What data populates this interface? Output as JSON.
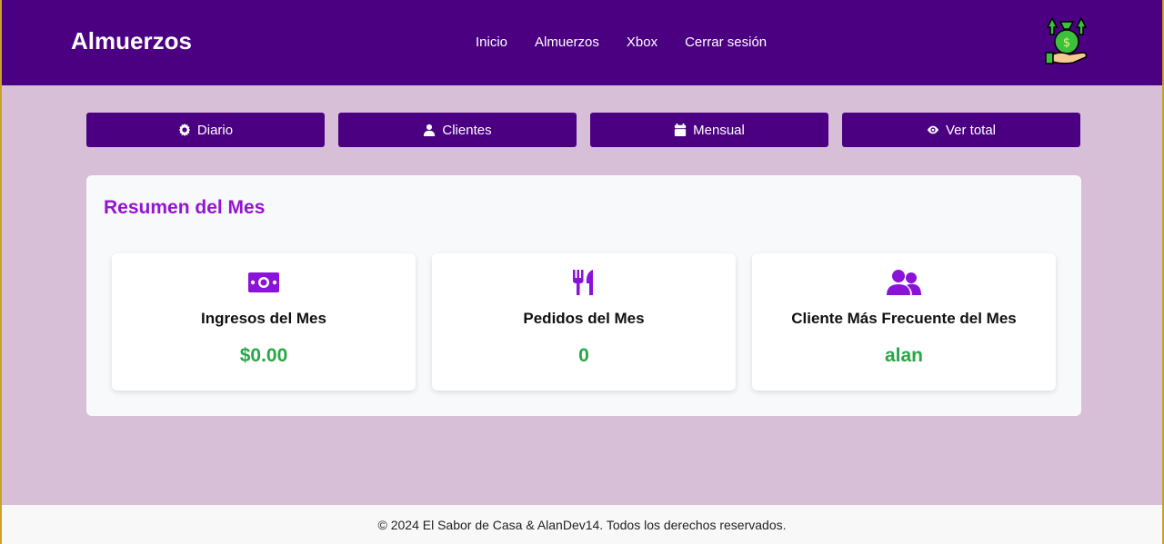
{
  "navbar": {
    "brand": "Almuerzos",
    "links": [
      "Inicio",
      "Almuerzos",
      "Xbox",
      "Cerrar sesión"
    ],
    "logo_icon": "money-bag-hand-icon"
  },
  "actions": [
    {
      "label": "Diario",
      "icon": "gear-icon"
    },
    {
      "label": "Clientes",
      "icon": "user-icon"
    },
    {
      "label": "Mensual",
      "icon": "calendar-icon"
    },
    {
      "label": "Ver total",
      "icon": "eye-icon"
    }
  ],
  "summary": {
    "title": "Resumen del Mes",
    "cards": [
      {
        "label": "Ingresos del Mes",
        "value": "$0.00",
        "icon": "money-bill-icon"
      },
      {
        "label": "Pedidos del Mes",
        "value": "0",
        "icon": "utensils-icon"
      },
      {
        "label": "Cliente Más Frecuente del Mes",
        "value": "alan",
        "icon": "users-icon"
      }
    ]
  },
  "footer": {
    "text": "© 2024 El Sabor de Casa & AlanDev14. Todos los derechos reservados."
  },
  "colors": {
    "primary": "#4b0082",
    "accent": "#9414d2",
    "success": "#28a745",
    "background": "#d8bfd8"
  }
}
